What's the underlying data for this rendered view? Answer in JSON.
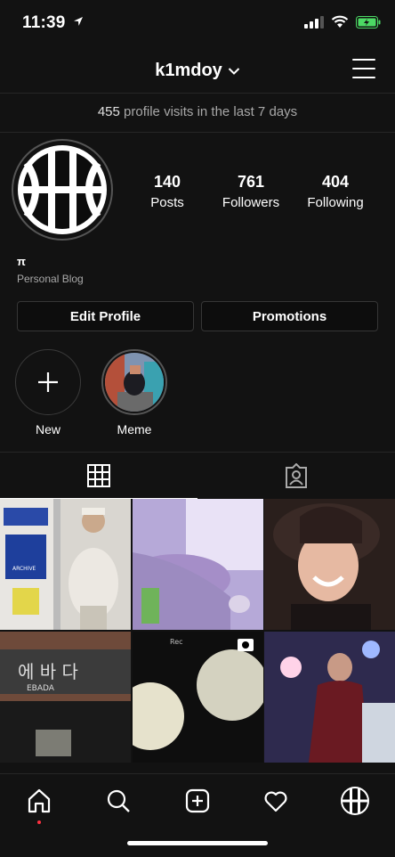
{
  "status": {
    "time": "11:39"
  },
  "header": {
    "username": "k1mdoy"
  },
  "visits": {
    "count": "455",
    "text": " profile visits in the last 7 days"
  },
  "stats": [
    {
      "num": "140",
      "label": "Posts"
    },
    {
      "num": "761",
      "label": "Followers"
    },
    {
      "num": "404",
      "label": "Following"
    }
  ],
  "bio": {
    "name": "π",
    "category": "Personal Blog"
  },
  "buttons": {
    "edit": "Edit Profile",
    "promotions": "Promotions"
  },
  "highlights": [
    {
      "label": "New"
    },
    {
      "label": "Meme"
    }
  ],
  "photos": [
    {
      "text": "ARCHIVE"
    },
    {
      "text": ""
    },
    {
      "text": ""
    },
    {
      "text": "에 바 다",
      "sub": "EBADA"
    },
    {
      "text": "Rec"
    },
    {
      "text": ""
    }
  ],
  "colors": {
    "battery": "#4cd964",
    "notification_dot": "#ff3040"
  }
}
